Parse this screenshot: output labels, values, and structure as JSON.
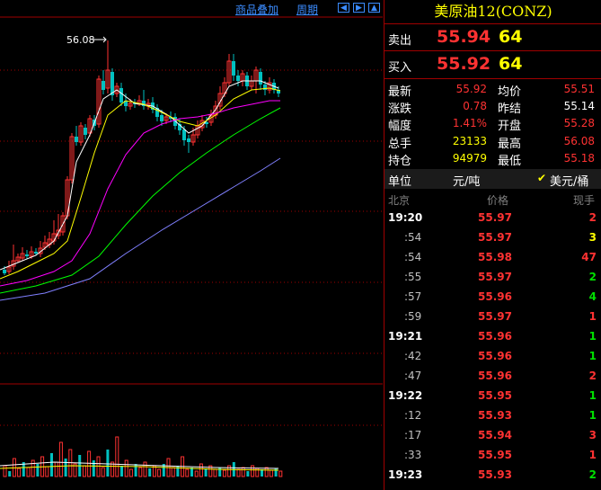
{
  "toolbar": {
    "overlay_label": "商品叠加",
    "period_label": "周期"
  },
  "nav_icons": [
    "arrow-left-icon",
    "arrow-right-icon",
    "arrow-up-icon"
  ],
  "chart": {
    "max_label": "56.08",
    "colors": {
      "up": "#ff3232",
      "down": "#00c0c0",
      "ma5": "#ffffff",
      "ma10": "#ffff00",
      "ma20": "#ff00ff",
      "ma40": "#00ff00",
      "ma60": "#8080ff"
    }
  },
  "header": {
    "symbol": "美原油12(CONZ)"
  },
  "bid_ask": {
    "sell_label": "卖出",
    "sell_price": "55.94",
    "sell_qty": "64",
    "buy_label": "买入",
    "buy_price": "55.92",
    "buy_qty": "64"
  },
  "stats": {
    "latest_label": "最新",
    "latest": "55.92",
    "avg_label": "均价",
    "avg": "55.51",
    "change_label": "涨跌",
    "change": "0.78",
    "prev_close_label": "昨结",
    "prev_close": "55.14",
    "pct_label": "幅度",
    "pct": "1.41%",
    "open_label": "开盘",
    "open": "55.28",
    "volume_label": "总手",
    "volume": "23133",
    "high_label": "最高",
    "high": "56.08",
    "oi_label": "持仓",
    "oi": "94979",
    "low_label": "最低",
    "low": "55.18"
  },
  "units": {
    "label": "单位",
    "unit_cny": "元/吨",
    "unit_usd": "美元/桶",
    "check_icon": "check-icon"
  },
  "ticks_header": {
    "time": "北京",
    "price": "价格",
    "qty": "现手"
  },
  "ticks": [
    {
      "time": "19:20",
      "price": "55.97",
      "qty": "2",
      "qty_color": "red",
      "major": true
    },
    {
      "time": ":54",
      "price": "55.97",
      "qty": "3",
      "qty_color": "yellow",
      "major": false
    },
    {
      "time": ":54",
      "price": "55.98",
      "qty": "47",
      "qty_color": "red",
      "major": false
    },
    {
      "time": ":55",
      "price": "55.97",
      "qty": "2",
      "qty_color": "green",
      "major": false
    },
    {
      "time": ":57",
      "price": "55.96",
      "qty": "4",
      "qty_color": "green",
      "major": false
    },
    {
      "time": ":59",
      "price": "55.97",
      "qty": "1",
      "qty_color": "red",
      "major": false
    },
    {
      "time": "19:21",
      "price": "55.96",
      "qty": "1",
      "qty_color": "green",
      "major": true
    },
    {
      "time": ":42",
      "price": "55.96",
      "qty": "1",
      "qty_color": "green",
      "major": false
    },
    {
      "time": ":47",
      "price": "55.96",
      "qty": "2",
      "qty_color": "red",
      "major": false
    },
    {
      "time": "19:22",
      "price": "55.95",
      "qty": "1",
      "qty_color": "green",
      "major": true
    },
    {
      "time": ":12",
      "price": "55.93",
      "qty": "1",
      "qty_color": "green",
      "major": false
    },
    {
      "time": ":17",
      "price": "55.94",
      "qty": "3",
      "qty_color": "red",
      "major": false
    },
    {
      "time": ":33",
      "price": "55.95",
      "qty": "1",
      "qty_color": "red",
      "major": false
    },
    {
      "time": "19:23",
      "price": "55.93",
      "qty": "2",
      "qty_color": "green",
      "major": true
    }
  ]
}
